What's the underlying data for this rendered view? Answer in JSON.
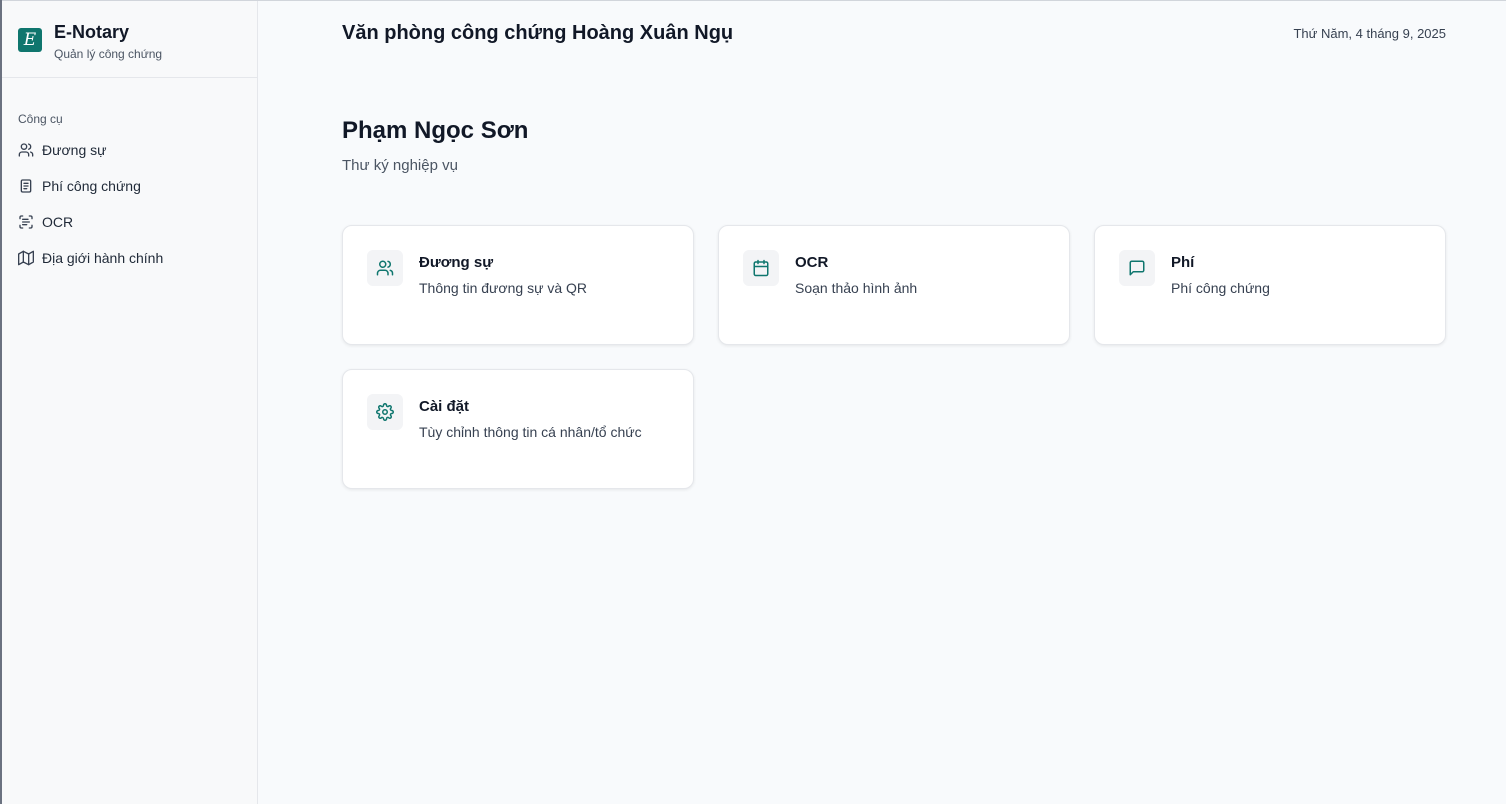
{
  "colors": {
    "accent": "#0f766e",
    "background": "#f8fafc",
    "sidebar_bg": "#f8f9fa",
    "card_bg": "#ffffff",
    "text_primary": "#111827",
    "text_secondary": "#4b5563"
  },
  "brand": {
    "logo_letter": "E",
    "name": "E-Notary",
    "subtitle": "Quản lý công chứng"
  },
  "sidebar": {
    "group_label": "Công cụ",
    "items": [
      {
        "label": "Đương sự",
        "icon": "users-icon"
      },
      {
        "label": "Phí công chứng",
        "icon": "document-icon"
      },
      {
        "label": "OCR",
        "icon": "scan-text-icon"
      },
      {
        "label": "Địa giới hành chính",
        "icon": "map-icon"
      }
    ]
  },
  "header": {
    "office_title": "Văn phòng công chứng Hoàng Xuân Ngụ",
    "date": "Thứ Năm, 4 tháng 9, 2025"
  },
  "user": {
    "name": "Phạm Ngọc Sơn",
    "role": "Thư ký nghiệp vụ"
  },
  "cards": [
    {
      "title": "Đương sự",
      "description": "Thông tin đương sự và QR",
      "icon": "users-icon"
    },
    {
      "title": "OCR",
      "description": "Soạn thảo hình ảnh",
      "icon": "calendar-icon"
    },
    {
      "title": "Phí",
      "description": "Phí công chứng",
      "icon": "message-square-icon"
    },
    {
      "title": "Cài đặt",
      "description": "Tùy chỉnh thông tin cá nhân/tổ chức",
      "icon": "settings-icon"
    }
  ]
}
